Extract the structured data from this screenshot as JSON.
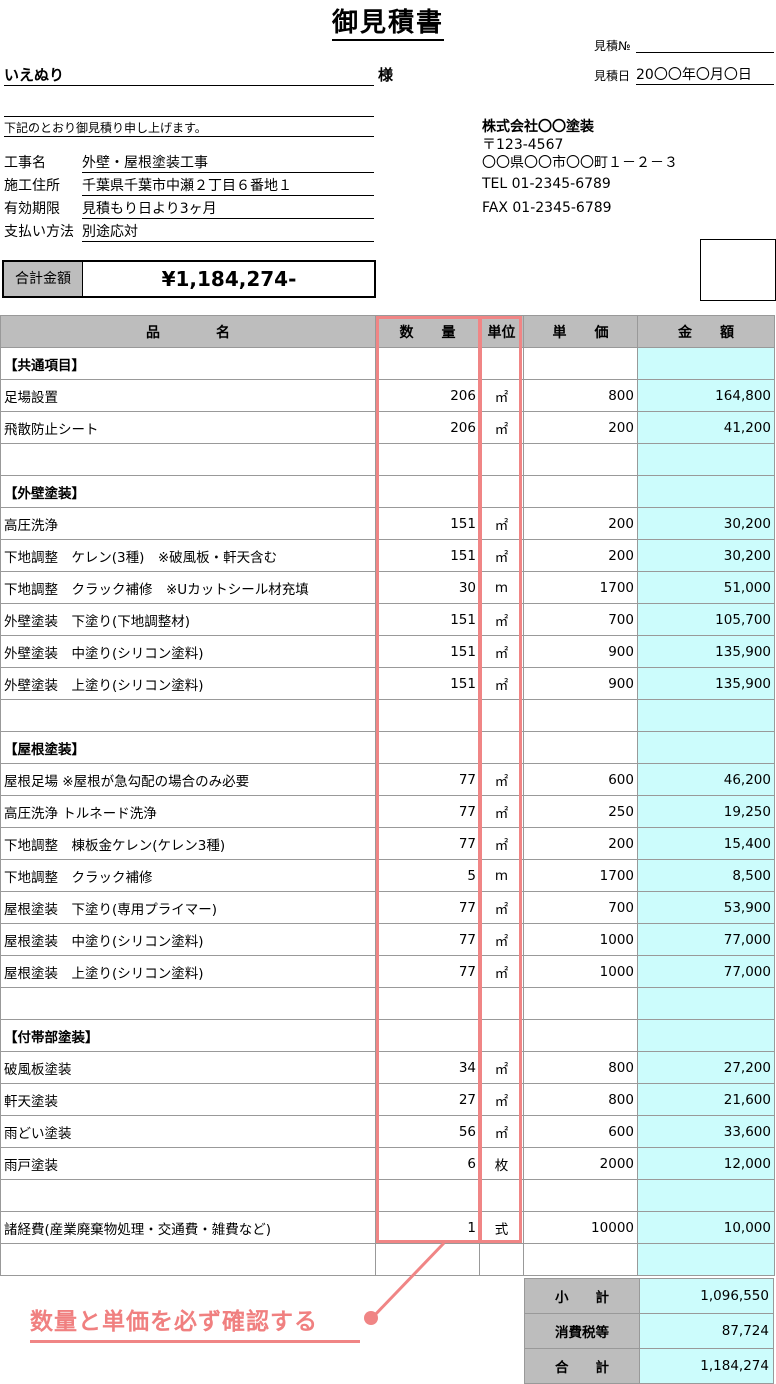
{
  "header": {
    "title": "御見積書",
    "no_label": "見積№",
    "date_label": "見積日",
    "date_value": "20〇〇年〇月〇日",
    "customer": "いえぬり",
    "honorific": "様",
    "intro": "下記のとおり御見積り申し上げます。",
    "project_label": "工事名",
    "project_value": "外壁・屋根塗装工事",
    "address_label": "施工住所",
    "address_value": "千葉県千葉市中瀬２丁目６番地１",
    "validity_label": "有効期限",
    "validity_value": "見積もり日より3ヶ月",
    "payment_label": "支払い方法",
    "payment_value": "別途応対",
    "total_label": "合計金額",
    "total_value": "¥1,184,274-"
  },
  "company": {
    "name": "株式会社〇〇塗装",
    "postal": "〒123-4567",
    "address": "〇〇県〇〇市〇〇町１－２－３",
    "tel": "TEL 01-2345-6789",
    "fax": "FAX 01-2345-6789"
  },
  "columns": {
    "item": "品　　　　名",
    "qty": "数　　量",
    "unit": "単位",
    "price": "単　　価",
    "amount": "金　　額"
  },
  "rows": [
    {
      "item": "【共通項目】",
      "qty": "",
      "unit": "",
      "price": "",
      "amount": ""
    },
    {
      "item": "足場設置",
      "qty": "206",
      "unit": "㎡",
      "price": "800",
      "amount": "164,800"
    },
    {
      "item": "飛散防止シート",
      "qty": "206",
      "unit": "㎡",
      "price": "200",
      "amount": "41,200"
    },
    {
      "item": "",
      "qty": "",
      "unit": "",
      "price": "",
      "amount": ""
    },
    {
      "item": "【外壁塗装】",
      "qty": "",
      "unit": "",
      "price": "",
      "amount": ""
    },
    {
      "item": "高圧洗浄",
      "qty": "151",
      "unit": "㎡",
      "price": "200",
      "amount": "30,200"
    },
    {
      "item": "下地調整　ケレン(3種)　※破風板・軒天含む",
      "qty": "151",
      "unit": "㎡",
      "price": "200",
      "amount": "30,200"
    },
    {
      "item": "下地調整　クラック補修　※Uカットシール材充填",
      "qty": "30",
      "unit": "m",
      "price": "1700",
      "amount": "51,000"
    },
    {
      "item": "外壁塗装　下塗り(下地調整材)",
      "qty": "151",
      "unit": "㎡",
      "price": "700",
      "amount": "105,700"
    },
    {
      "item": "外壁塗装　中塗り(シリコン塗料)",
      "qty": "151",
      "unit": "㎡",
      "price": "900",
      "amount": "135,900"
    },
    {
      "item": "外壁塗装　上塗り(シリコン塗料)",
      "qty": "151",
      "unit": "㎡",
      "price": "900",
      "amount": "135,900"
    },
    {
      "item": "",
      "qty": "",
      "unit": "",
      "price": "",
      "amount": ""
    },
    {
      "item": "【屋根塗装】",
      "qty": "",
      "unit": "",
      "price": "",
      "amount": ""
    },
    {
      "item": "屋根足場 ※屋根が急勾配の場合のみ必要",
      "qty": "77",
      "unit": "㎡",
      "price": "600",
      "amount": "46,200"
    },
    {
      "item": "高圧洗浄 トルネード洗浄",
      "qty": "77",
      "unit": "㎡",
      "price": "250",
      "amount": "19,250"
    },
    {
      "item": "下地調整　棟板金ケレン(ケレン3種)",
      "qty": "77",
      "unit": "㎡",
      "price": "200",
      "amount": "15,400"
    },
    {
      "item": "下地調整　クラック補修",
      "qty": "5",
      "unit": "m",
      "price": "1700",
      "amount": "8,500"
    },
    {
      "item": "屋根塗装　下塗り(専用プライマー)",
      "qty": "77",
      "unit": "㎡",
      "price": "700",
      "amount": "53,900"
    },
    {
      "item": "屋根塗装　中塗り(シリコン塗料)",
      "qty": "77",
      "unit": "㎡",
      "price": "1000",
      "amount": "77,000"
    },
    {
      "item": "屋根塗装　上塗り(シリコン塗料)",
      "qty": "77",
      "unit": "㎡",
      "price": "1000",
      "amount": "77,000"
    },
    {
      "item": "",
      "qty": "",
      "unit": "",
      "price": "",
      "amount": ""
    },
    {
      "item": "【付帯部塗装】",
      "qty": "",
      "unit": "",
      "price": "",
      "amount": ""
    },
    {
      "item": "破風板塗装",
      "qty": "34",
      "unit": "㎡",
      "price": "800",
      "amount": "27,200"
    },
    {
      "item": "軒天塗装",
      "qty": "27",
      "unit": "㎡",
      "price": "800",
      "amount": "21,600"
    },
    {
      "item": "雨どい塗装",
      "qty": "56",
      "unit": "㎡",
      "price": "600",
      "amount": "33,600"
    },
    {
      "item": "雨戸塗装",
      "qty": "6",
      "unit": "枚",
      "price": "2000",
      "amount": "12,000"
    },
    {
      "item": "",
      "qty": "",
      "unit": "",
      "price": "",
      "amount": ""
    },
    {
      "item": "諸経費(産業廃棄物処理・交通費・雑費など)",
      "qty": "1",
      "unit": "式",
      "price": "10000",
      "amount": "10,000"
    },
    {
      "item": "",
      "qty": "",
      "unit": "",
      "price": "",
      "amount": ""
    }
  ],
  "totals": {
    "subtotal_label": "小　　計",
    "subtotal_value": "1,096,550",
    "tax_label": "消費税等",
    "tax_value": "87,724",
    "total_label": "合　　計",
    "total_value": "1,184,274"
  },
  "annotation": {
    "text": "数量と単価を必ず確認する",
    "color": "#f08585"
  }
}
